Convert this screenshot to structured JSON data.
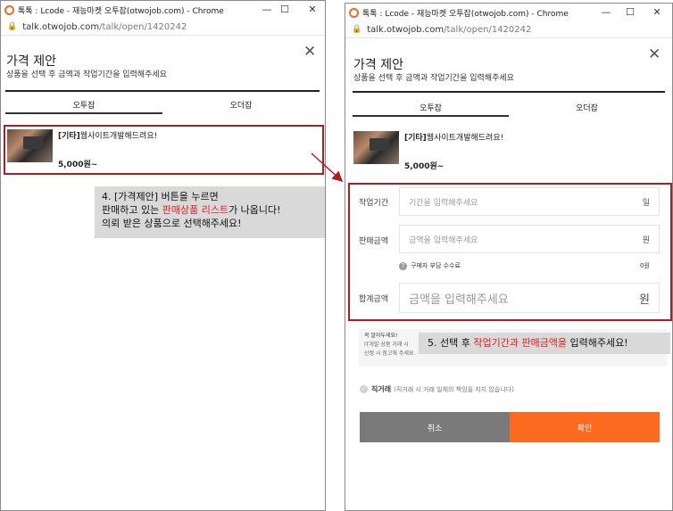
{
  "window1": {
    "title": "톡톡 : Lcode - 재능마켓 오투잡(otwojob.com) - Chrome",
    "address": {
      "host": "talk.otwojob.com",
      "path": "/talk/open/1420242"
    },
    "modal_title": "가격 제안",
    "modal_subtitle": "상품을 선택 후 금액과 작업기간을 입력해주세요",
    "tabs": [
      "오투잡",
      "오더잡"
    ],
    "product": {
      "category": "[기타]",
      "title": "웹사이트개발해드려요!",
      "price": "5,000원~"
    },
    "callout": {
      "line1": "4. [가격제안] 버튼을 누르면",
      "line2_pre": "판매하고 있는 ",
      "line2_hl": "판매상품 리스트",
      "line2_post": "가 나옵니다!",
      "line3": "의뢰 받은 상품으로 선택해주세요!"
    }
  },
  "window2": {
    "title": "톡톡 : Lcode - 재능마켓 오투잡(otwojob.com) - Chrome",
    "address": {
      "host": "talk.otwojob.com",
      "path": "/talk/open/1420242"
    },
    "modal_title": "가격 제안",
    "modal_subtitle": "상품을 선택 후 금액과 작업기간을 입력해주세요",
    "tabs": [
      "오투잡",
      "오더잡"
    ],
    "product": {
      "category": "[기타]",
      "title": "웹사이트개발해드려요!",
      "price": "5,000원~"
    },
    "form": {
      "period_label": "작업기간",
      "period_placeholder": "기간을 입력해주세요",
      "period_unit": "일",
      "price_label": "판매금액",
      "price_placeholder": "금액을 입력해주세요",
      "price_unit": "원",
      "fee_label": "구매자 부담 수수료",
      "fee_value": "0원",
      "total_label": "합계금액",
      "total_placeholder": "금액을 입력해주세요",
      "total_unit": "원"
    },
    "notice": {
      "line1": "꼭 알아두세요!",
      "line2": "IT개발 상품 거래 시",
      "line3": "산정 시 참고해 주세요."
    },
    "callout": {
      "pre": "5. 선택 후 ",
      "hl": "작업기간과 판매금액을",
      "post": " 입력해주세요!"
    },
    "direct_deal": {
      "label": "직거래",
      "note": "(직거래 시 거래 일체의 책임을 지지 않습니다)"
    },
    "buttons": {
      "cancel": "취소",
      "confirm": "확인"
    }
  },
  "window_controls": {
    "minimize": "—",
    "maximize": "☐",
    "close": "✕"
  },
  "colors": {
    "accent": "#fb6a1e",
    "highlight_border": "#b01d1d",
    "highlight_text": "#e02020"
  }
}
